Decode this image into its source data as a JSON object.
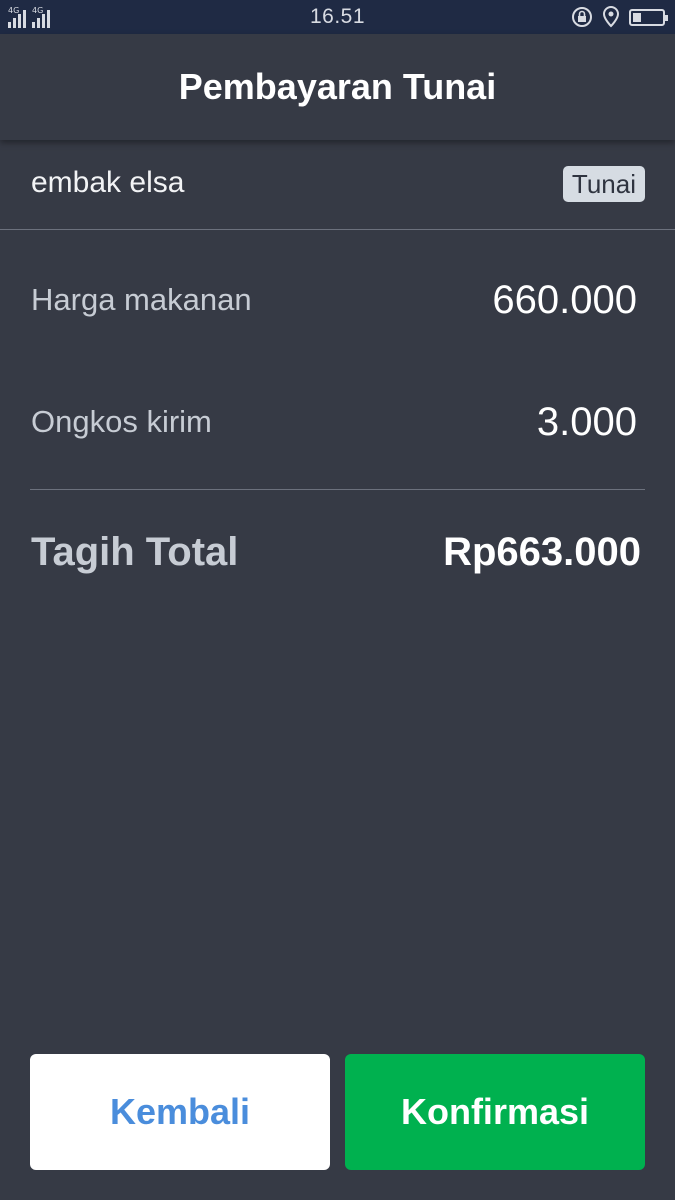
{
  "status_bar": {
    "time": "16.51",
    "network_label_1": "4G",
    "network_label_2": "4G",
    "icons": [
      "signal-icon",
      "signal-icon",
      "rotation-lock-icon",
      "location-icon",
      "battery-icon"
    ],
    "battery_level": 0.28
  },
  "header": {
    "title": "Pembayaran Tunai"
  },
  "order": {
    "customer_name": "embak elsa",
    "payment_method": "Tunai"
  },
  "breakdown": {
    "food_label": "Harga makanan",
    "food_value": "660.000",
    "delivery_label": "Ongkos kirim",
    "delivery_value": "3.000"
  },
  "total": {
    "label": "Tagih Total",
    "value": "Rp663.000"
  },
  "actions": {
    "back_label": "Kembali",
    "confirm_label": "Konfirmasi"
  },
  "colors": {
    "background": "#363a45",
    "status_bar": "#1f2a44",
    "confirm_button": "#00b14f",
    "back_button_text": "#4a8ddc"
  }
}
